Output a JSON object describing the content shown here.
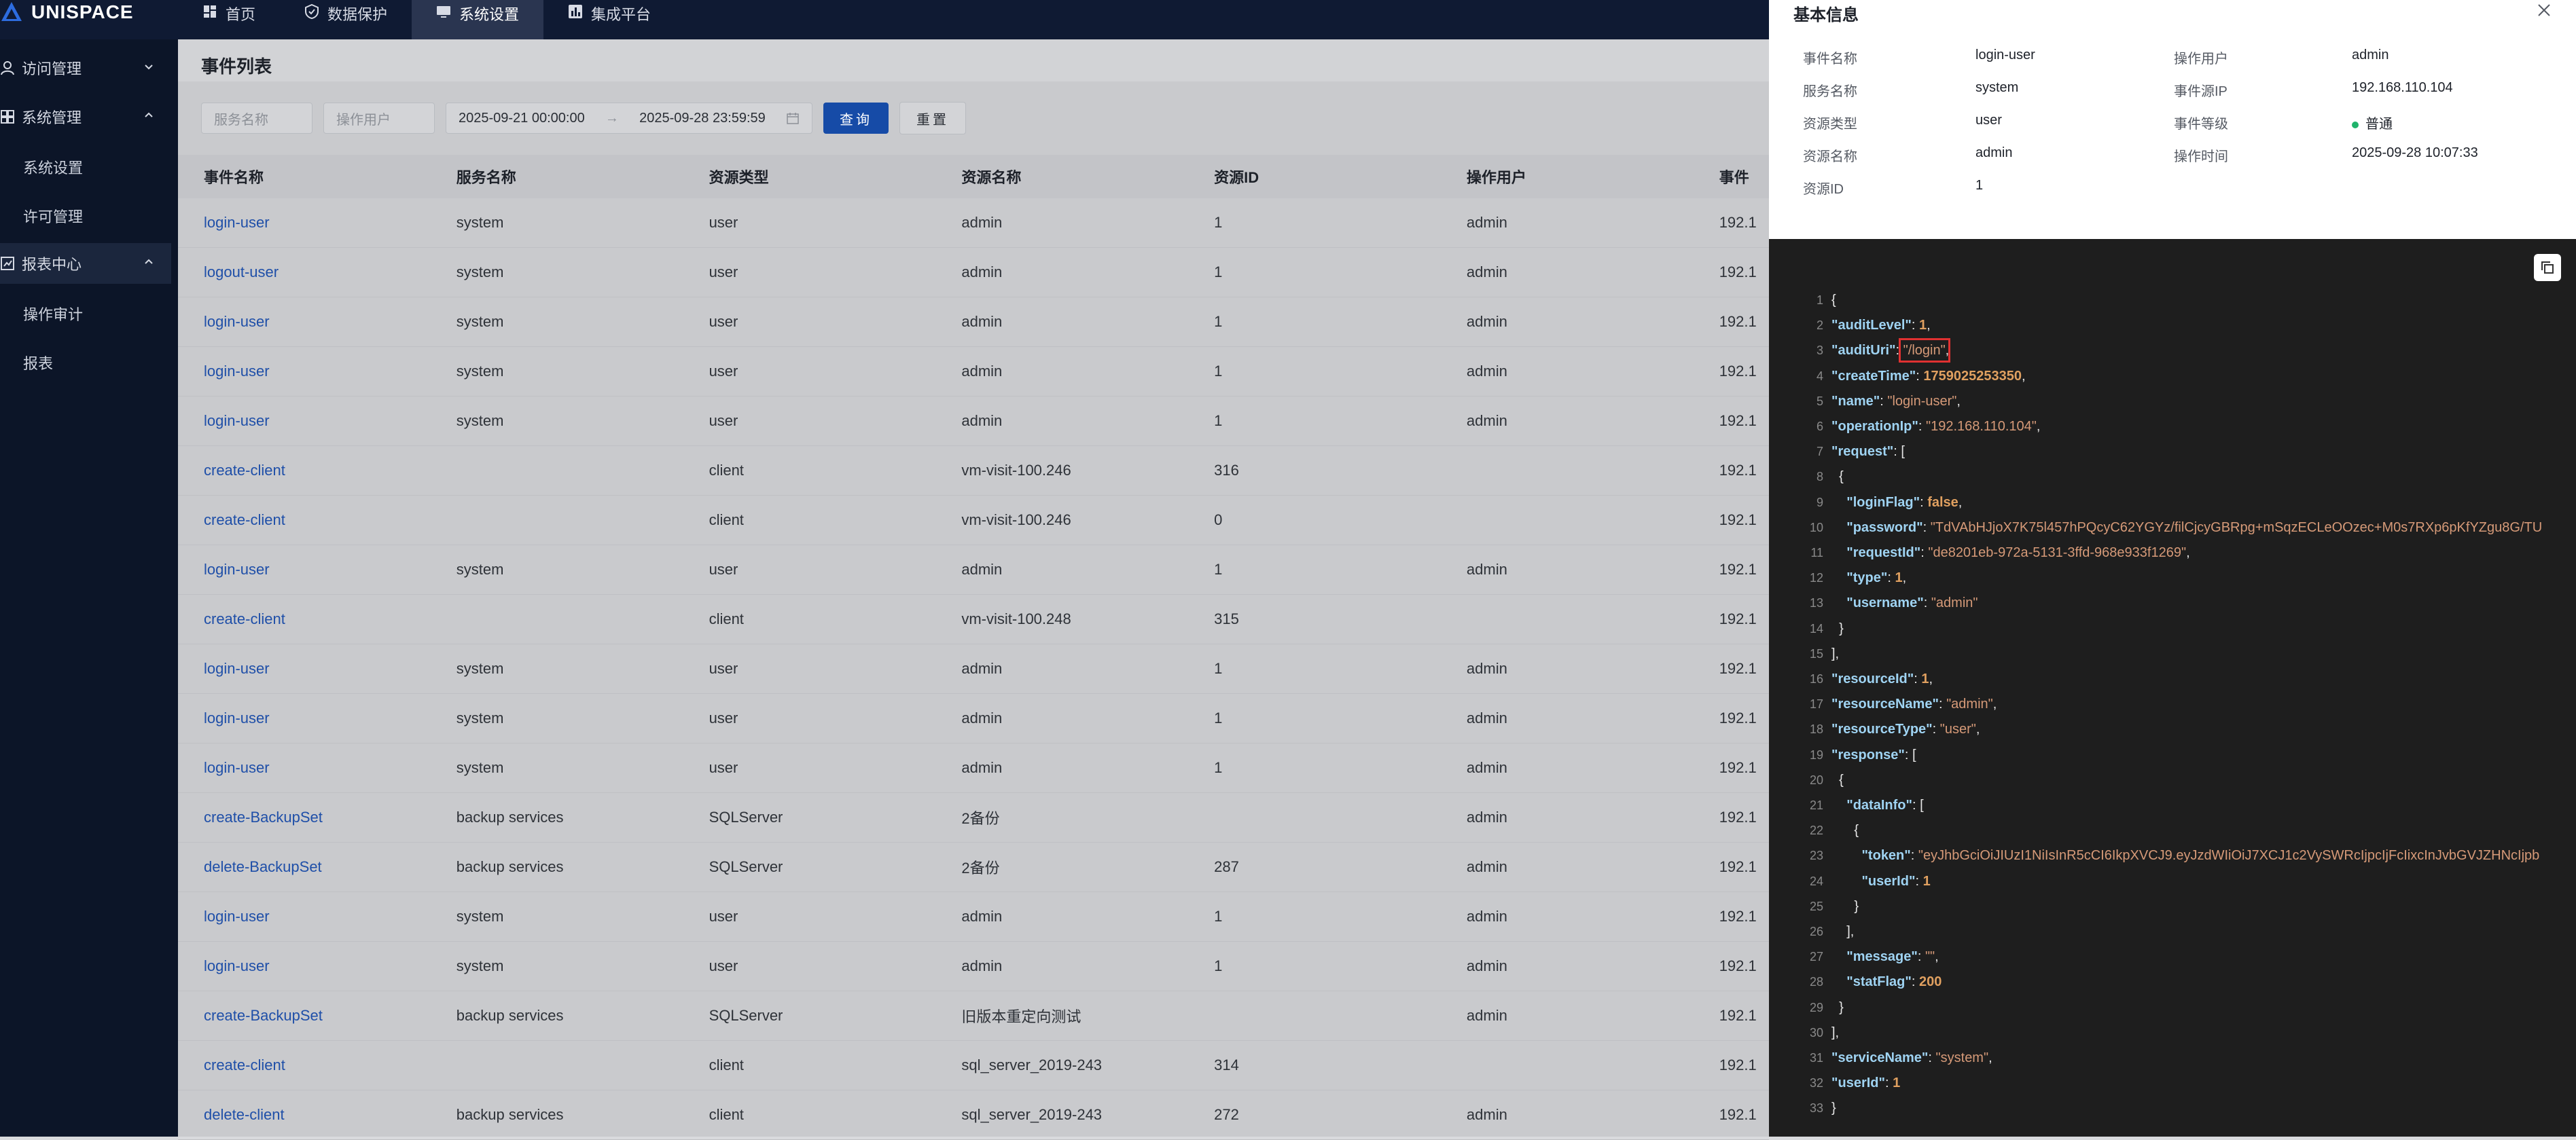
{
  "app": {
    "logo_text": "UNISPACE"
  },
  "nav": [
    {
      "label": "首页",
      "icon": "dashboard-icon"
    },
    {
      "label": "数据保护",
      "icon": "shield-icon"
    },
    {
      "label": "系统设置",
      "icon": "monitor-icon",
      "active": true
    },
    {
      "label": "集成平台",
      "icon": "chart-icon"
    }
  ],
  "sidebar": {
    "groups": [
      {
        "label": "访问管理"
      },
      {
        "label": "系统管理"
      },
      {
        "label": "报表中心"
      }
    ],
    "items": [
      {
        "label": "系统设置"
      },
      {
        "label": "许可管理"
      },
      {
        "label": "操作审计"
      },
      {
        "label": "报表"
      }
    ]
  },
  "main": {
    "title": "事件列表",
    "filters": {
      "service_placeholder": "服务名称",
      "user_placeholder": "操作用户",
      "date_start": "2025-09-21 00:00:00",
      "date_sep": "→",
      "date_end": "2025-09-28 23:59:59",
      "query_label": "查询",
      "reset_label": "重置"
    },
    "columns": [
      "事件名称",
      "服务名称",
      "资源类型",
      "资源名称",
      "资源ID",
      "操作用户",
      "事件"
    ],
    "rows": [
      [
        "login-user",
        "system",
        "user",
        "admin",
        "1",
        "admin",
        "192.1"
      ],
      [
        "logout-user",
        "system",
        "user",
        "admin",
        "1",
        "admin",
        "192.1"
      ],
      [
        "login-user",
        "system",
        "user",
        "admin",
        "1",
        "admin",
        "192.1"
      ],
      [
        "login-user",
        "system",
        "user",
        "admin",
        "1",
        "admin",
        "192.1"
      ],
      [
        "login-user",
        "system",
        "user",
        "admin",
        "1",
        "admin",
        "192.1"
      ],
      [
        "create-client",
        "",
        "client",
        "vm-visit-100.246",
        "316",
        "",
        "192.1"
      ],
      [
        "create-client",
        "",
        "client",
        "vm-visit-100.246",
        "0",
        "",
        "192.1"
      ],
      [
        "login-user",
        "system",
        "user",
        "admin",
        "1",
        "admin",
        "192.1"
      ],
      [
        "create-client",
        "",
        "client",
        "vm-visit-100.248",
        "315",
        "",
        "192.1"
      ],
      [
        "login-user",
        "system",
        "user",
        "admin",
        "1",
        "admin",
        "192.1"
      ],
      [
        "login-user",
        "system",
        "user",
        "admin",
        "1",
        "admin",
        "192.1"
      ],
      [
        "login-user",
        "system",
        "user",
        "admin",
        "1",
        "admin",
        "192.1"
      ],
      [
        "create-BackupSet",
        "backup services",
        "SQLServer",
        "2备份",
        "",
        "admin",
        "192.1"
      ],
      [
        "delete-BackupSet",
        "backup services",
        "SQLServer",
        "2备份",
        "287",
        "admin",
        "192.1"
      ],
      [
        "login-user",
        "system",
        "user",
        "admin",
        "1",
        "admin",
        "192.1"
      ],
      [
        "login-user",
        "system",
        "user",
        "admin",
        "1",
        "admin",
        "192.1"
      ],
      [
        "create-BackupSet",
        "backup services",
        "SQLServer",
        "旧版本重定向测试",
        "",
        "admin",
        "192.1"
      ],
      [
        "create-client",
        "",
        "client",
        "sql_server_2019-243",
        "314",
        "",
        "192.1"
      ],
      [
        "delete-client",
        "backup services",
        "client",
        "sql_server_2019-243",
        "272",
        "admin",
        "192.1"
      ]
    ]
  },
  "drawer": {
    "title": "基本信息",
    "info": [
      {
        "label": "事件名称",
        "value": "login-user",
        "label2": "操作用户",
        "value2": "admin"
      },
      {
        "label": "服务名称",
        "value": "system",
        "label2": "事件源IP",
        "value2": "192.168.110.104"
      },
      {
        "label": "资源类型",
        "value": "user",
        "label2": "事件等级",
        "value2": "普通"
      },
      {
        "label": "资源名称",
        "value": "admin",
        "label2": "操作时间",
        "value2": "2025-09-28 10:07:33"
      },
      {
        "label": "资源ID",
        "value": "1",
        "label2": "",
        "value2": ""
      }
    ],
    "level_color": "#1fb36b",
    "code_lines": [
      [
        [
          "p",
          "{"
        ]
      ],
      [
        [
          "k",
          "\"auditLevel\""
        ],
        [
          "p",
          ": "
        ],
        [
          "n",
          "1"
        ],
        [
          "p",
          ","
        ]
      ],
      [
        [
          "k",
          "\"auditUri\""
        ],
        [
          "p",
          ": "
        ],
        [
          "s",
          "\"/login\""
        ],
        [
          "p",
          ","
        ]
      ],
      [
        [
          "k",
          "\"createTime\""
        ],
        [
          "p",
          ": "
        ],
        [
          "n",
          "1759025253350"
        ],
        [
          "p",
          ","
        ]
      ],
      [
        [
          "k",
          "\"name\""
        ],
        [
          "p",
          ": "
        ],
        [
          "s",
          "\"login-user\""
        ],
        [
          "p",
          ","
        ]
      ],
      [
        [
          "k",
          "\"operationIp\""
        ],
        [
          "p",
          ": "
        ],
        [
          "s",
          "\"192.168.110.104\""
        ],
        [
          "p",
          ","
        ]
      ],
      [
        [
          "k",
          "\"request\""
        ],
        [
          "p",
          ": ["
        ]
      ],
      [
        [
          "p",
          "  {"
        ]
      ],
      [
        [
          "k",
          "    \"loginFlag\""
        ],
        [
          "p",
          ": "
        ],
        [
          "n",
          "false"
        ],
        [
          "p",
          ","
        ]
      ],
      [
        [
          "k",
          "    \"password\""
        ],
        [
          "p",
          ": "
        ],
        [
          "s",
          "\"TdVAbHJjoX7K75l457hPQcyC62YGYz/filCjcyGBRpg+mSqzECLeOOzec+M0s7RXp6pKfYZgu8G/TU"
        ]
      ],
      [
        [
          "k",
          "    \"requestId\""
        ],
        [
          "p",
          ": "
        ],
        [
          "s",
          "\"de8201eb-972a-5131-3ffd-968e933f1269\""
        ],
        [
          "p",
          ","
        ]
      ],
      [
        [
          "k",
          "    \"type\""
        ],
        [
          "p",
          ": "
        ],
        [
          "n",
          "1"
        ],
        [
          "p",
          ","
        ]
      ],
      [
        [
          "k",
          "    \"username\""
        ],
        [
          "p",
          ": "
        ],
        [
          "s",
          "\"admin\""
        ]
      ],
      [
        [
          "p",
          "  }"
        ]
      ],
      [
        [
          "p",
          "],"
        ]
      ],
      [
        [
          "k",
          "\"resourceId\""
        ],
        [
          "p",
          ": "
        ],
        [
          "n",
          "1"
        ],
        [
          "p",
          ","
        ]
      ],
      [
        [
          "k",
          "\"resourceName\""
        ],
        [
          "p",
          ": "
        ],
        [
          "s",
          "\"admin\""
        ],
        [
          "p",
          ","
        ]
      ],
      [
        [
          "k",
          "\"resourceType\""
        ],
        [
          "p",
          ": "
        ],
        [
          "s",
          "\"user\""
        ],
        [
          "p",
          ","
        ]
      ],
      [
        [
          "k",
          "\"response\""
        ],
        [
          "p",
          ": ["
        ]
      ],
      [
        [
          "p",
          "  {"
        ]
      ],
      [
        [
          "k",
          "    \"dataInfo\""
        ],
        [
          "p",
          ": ["
        ]
      ],
      [
        [
          "p",
          "      {"
        ]
      ],
      [
        [
          "k",
          "        \"token\""
        ],
        [
          "p",
          ": "
        ],
        [
          "s",
          "\"eyJhbGciOiJIUzI1NiIsInR5cCI6IkpXVCJ9.eyJzdWIiOiJ7XCJ1c2VySWRcIjpcIjFcIixcInJvbGVJZHNcIjpb"
        ]
      ],
      [
        [
          "k",
          "        \"userId\""
        ],
        [
          "p",
          ": "
        ],
        [
          "n",
          "1"
        ]
      ],
      [
        [
          "p",
          "      }"
        ]
      ],
      [
        [
          "p",
          "    ],"
        ]
      ],
      [
        [
          "k",
          "    \"message\""
        ],
        [
          "p",
          ": "
        ],
        [
          "s",
          "\"\""
        ],
        [
          "p",
          ","
        ]
      ],
      [
        [
          "k",
          "    \"statFlag\""
        ],
        [
          "p",
          ": "
        ],
        [
          "n",
          "200"
        ]
      ],
      [
        [
          "p",
          "  }"
        ]
      ],
      [
        [
          "p",
          "],"
        ]
      ],
      [
        [
          "k",
          "\"serviceName\""
        ],
        [
          "p",
          ": "
        ],
        [
          "s",
          "\"system\""
        ],
        [
          "p",
          ","
        ]
      ],
      [
        [
          "k",
          "\"userId\""
        ],
        [
          "p",
          ": "
        ],
        [
          "n",
          "1"
        ]
      ],
      [
        [
          "p",
          "}"
        ]
      ]
    ]
  }
}
